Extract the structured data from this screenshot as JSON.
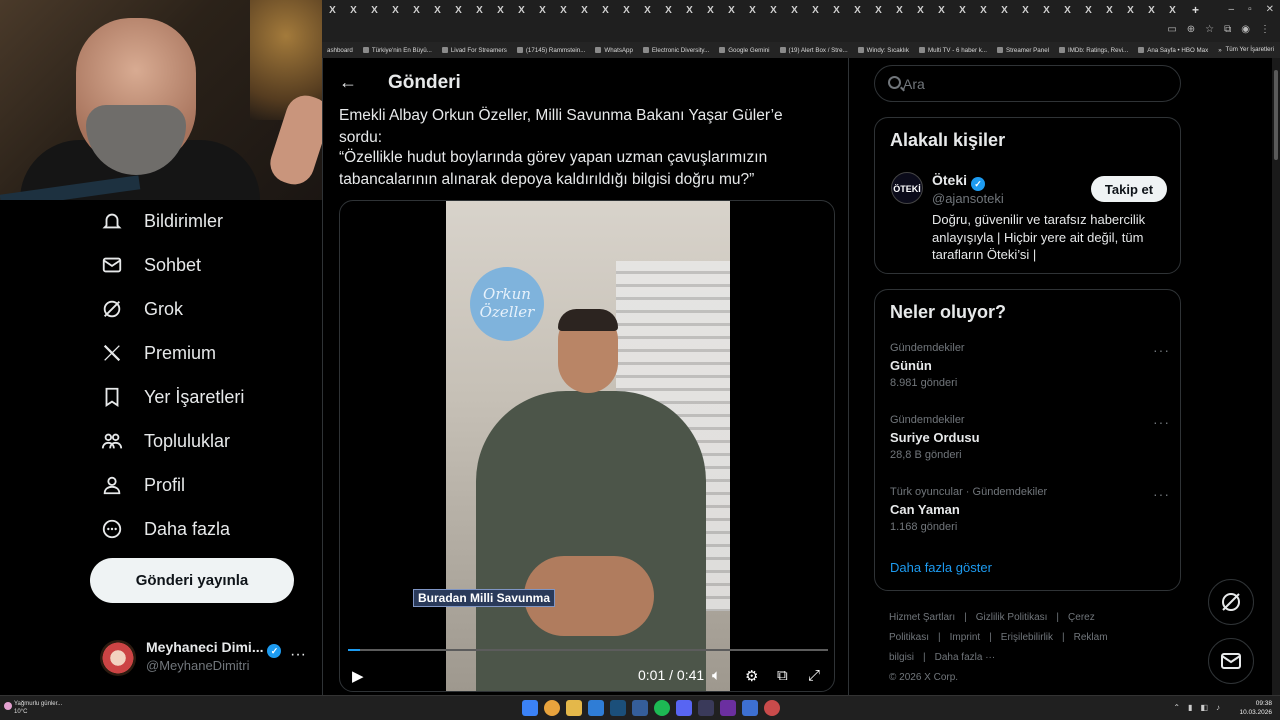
{
  "browser": {
    "tab_count": 41,
    "tab_glyph": "X",
    "new_tab_glyph": "+",
    "bookmarks": [
      "ashboard",
      "Türkiye'nin En Büyü...",
      "Livad For Streamers",
      "(17145) Rammstein...",
      "WhatsApp",
      "Electronic Diversity...",
      "Google Gemini",
      "(19) Alert Box / Stre...",
      "Windy: Sıcaklık",
      "Multi TV - 6 haber k...",
      "Streamer Panel",
      "IMDb: Ratings, Revi...",
      "Ana Sayfa • HBO Max"
    ],
    "bookmarks_overflow": "»",
    "all_bookmarks": "Tüm Yer İşaretleri"
  },
  "left_nav": {
    "items": [
      {
        "label": "Bildirimler",
        "icon": "bell-icon"
      },
      {
        "label": "Sohbet",
        "icon": "mail-icon"
      },
      {
        "label": "Grok",
        "icon": "grok-icon"
      },
      {
        "label": "Premium",
        "icon": "x-logo-icon"
      },
      {
        "label": "Yer İşaretleri",
        "icon": "bookmark-icon"
      },
      {
        "label": "Topluluklar",
        "icon": "communities-icon"
      },
      {
        "label": "Profil",
        "icon": "person-icon"
      },
      {
        "label": "Daha fazla",
        "icon": "more-circle-icon"
      }
    ],
    "post_button": "Gönderi yayınla",
    "account": {
      "name": "Meyhaneci Dimi...",
      "handle": "@MeyhaneDimitri",
      "more": "···"
    }
  },
  "main": {
    "back": "←",
    "title": "Gönderi",
    "post_line1": "Emekli Albay Orkun Özeller, Milli Savunma Bakanı Yaşar Güler’e sordu:",
    "post_line2": "“Özellikle hudut boylarında görev yapan uzman çavuşlarımızın tabancalarının alınarak depoya kaldırıldığı bilgisi doğru mu?”",
    "video": {
      "logo_text": "Orkun Özeller",
      "caption": "Buradan Milli Savunma",
      "time": "0:01 / 0:41",
      "progress": 0.024
    }
  },
  "right": {
    "search_placeholder": "Ara",
    "related": {
      "title": "Alakalı kişiler",
      "avatar_text": "ÖTEKİ",
      "name": "Öteki",
      "handle": "@ajansoteki",
      "bio": "Doğru, güvenilir ve tarafsız habercilik anlayışıyla | Hiçbir yere ait değil, tüm tarafların Öteki’si |",
      "follow": "Takip et"
    },
    "trends": {
      "title": "Neler oluyor?",
      "items": [
        {
          "category": "Gündemdekiler",
          "name": "Günün",
          "count": "8.981 gönderi"
        },
        {
          "category": "Gündemdekiler",
          "name": "Suriye Ordusu",
          "count": "28,8 B gönderi"
        },
        {
          "category": "Türk oyuncular · Gündemdekiler",
          "name": "Can Yaman",
          "count": "1.168 gönderi"
        }
      ],
      "more_glyph": "···",
      "show_more": "Daha fazla göster"
    },
    "footer": [
      "Hizmet Şartları",
      "|",
      "Gizlilik Politikası",
      "|",
      "Çerez Politikası",
      "|",
      "Imprint",
      "|",
      "Erişilebilirlik",
      "|",
      "Reklam bilgisi",
      "|",
      "Daha fazla ···",
      "© 2026 X Corp."
    ]
  },
  "taskbar": {
    "weather_line1": "Yağmurlu günler...",
    "weather_line2": "10°C",
    "time": "09:38",
    "date": "10.03.2026"
  }
}
